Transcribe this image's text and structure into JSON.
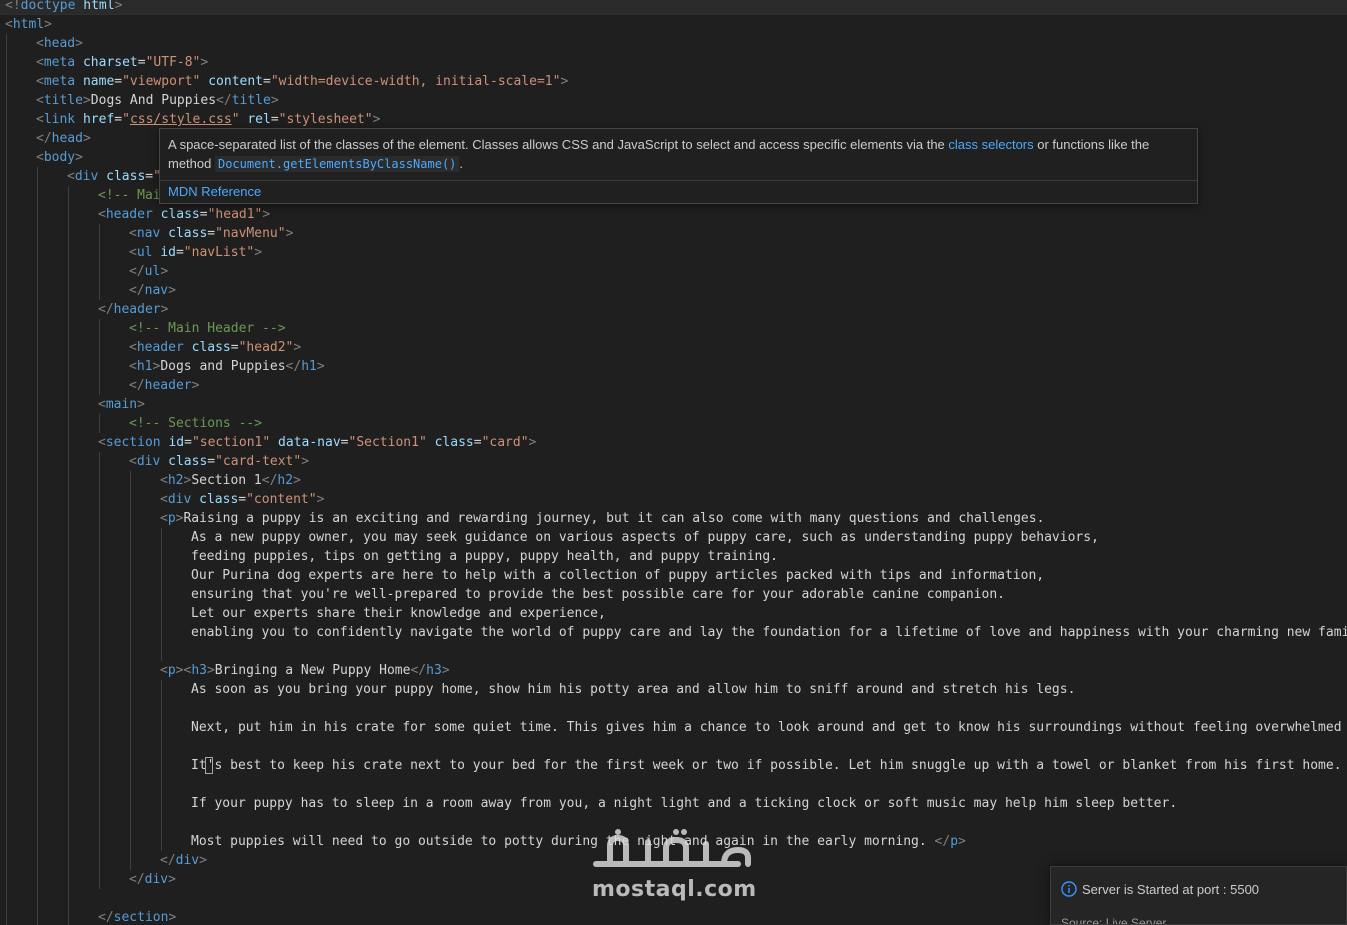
{
  "code_lines": [
    {
      "indent": 0,
      "tokens": [
        {
          "c": "br",
          "t": "<!"
        },
        {
          "c": "kw",
          "t": "doctype"
        },
        {
          "c": "text",
          "t": " "
        },
        {
          "c": "attr",
          "t": "html"
        },
        {
          "c": "br",
          "t": ">"
        }
      ]
    },
    {
      "indent": 0,
      "tokens": [
        {
          "c": "br",
          "t": "<"
        },
        {
          "c": "tag",
          "t": "html"
        },
        {
          "c": "br",
          "t": ">"
        }
      ]
    },
    {
      "indent": 1,
      "tokens": [
        {
          "c": "br",
          "t": "<"
        },
        {
          "c": "tag",
          "t": "head"
        },
        {
          "c": "br",
          "t": ">"
        }
      ]
    },
    {
      "indent": 1,
      "tokens": [
        {
          "c": "br",
          "t": "<"
        },
        {
          "c": "tag",
          "t": "meta"
        },
        {
          "c": "text",
          "t": " "
        },
        {
          "c": "attr",
          "t": "charset"
        },
        {
          "c": "eq",
          "t": "="
        },
        {
          "c": "str",
          "t": "\"UTF-8\""
        },
        {
          "c": "br",
          "t": ">"
        }
      ]
    },
    {
      "indent": 1,
      "tokens": [
        {
          "c": "br",
          "t": "<"
        },
        {
          "c": "tag",
          "t": "meta"
        },
        {
          "c": "text",
          "t": " "
        },
        {
          "c": "attr",
          "t": "name"
        },
        {
          "c": "eq",
          "t": "="
        },
        {
          "c": "str",
          "t": "\"viewport\""
        },
        {
          "c": "text",
          "t": " "
        },
        {
          "c": "attr",
          "t": "content"
        },
        {
          "c": "eq",
          "t": "="
        },
        {
          "c": "str",
          "t": "\"width=device-width, initial-scale=1\""
        },
        {
          "c": "br",
          "t": ">"
        }
      ]
    },
    {
      "indent": 1,
      "tokens": [
        {
          "c": "br",
          "t": "<"
        },
        {
          "c": "tag",
          "t": "title"
        },
        {
          "c": "br",
          "t": ">"
        },
        {
          "c": "text",
          "t": "Dogs And Puppies"
        },
        {
          "c": "br",
          "t": "</"
        },
        {
          "c": "tag",
          "t": "title"
        },
        {
          "c": "br",
          "t": ">"
        }
      ]
    },
    {
      "indent": 1,
      "tokens": [
        {
          "c": "br",
          "t": "<"
        },
        {
          "c": "tag",
          "t": "link"
        },
        {
          "c": "text",
          "t": " "
        },
        {
          "c": "attr",
          "t": "href"
        },
        {
          "c": "eq",
          "t": "="
        },
        {
          "c": "str",
          "t": "\""
        },
        {
          "c": "link",
          "t": "css/style.css"
        },
        {
          "c": "str",
          "t": "\""
        },
        {
          "c": "text",
          "t": " "
        },
        {
          "c": "attr",
          "t": "rel"
        },
        {
          "c": "eq",
          "t": "="
        },
        {
          "c": "str",
          "t": "\"stylesheet\""
        },
        {
          "c": "br",
          "t": ">"
        }
      ]
    },
    {
      "indent": 1,
      "tokens": [
        {
          "c": "br",
          "t": "</"
        },
        {
          "c": "tag",
          "t": "head"
        },
        {
          "c": "br",
          "t": ">"
        }
      ]
    },
    {
      "indent": 1,
      "tokens": [
        {
          "c": "br",
          "t": "<"
        },
        {
          "c": "tag",
          "t": "body"
        },
        {
          "c": "br",
          "t": ">"
        }
      ]
    },
    {
      "indent": 2,
      "tokens": [
        {
          "c": "br",
          "t": "<"
        },
        {
          "c": "tag",
          "t": "div"
        },
        {
          "c": "text",
          "t": " "
        },
        {
          "c": "attr",
          "t": "class"
        },
        {
          "c": "eq",
          "t": "="
        },
        {
          "c": "str",
          "t": "\""
        }
      ]
    },
    {
      "indent": 3,
      "tokens": [
        {
          "c": "com",
          "t": "<!-- Mai"
        }
      ]
    },
    {
      "indent": 3,
      "tokens": [
        {
          "c": "br",
          "t": "<"
        },
        {
          "c": "tag",
          "t": "header"
        },
        {
          "c": "text",
          "t": " "
        },
        {
          "c": "attr",
          "t": "class"
        },
        {
          "c": "eq",
          "t": "="
        },
        {
          "c": "str",
          "t": "\"head1\""
        },
        {
          "c": "br",
          "t": ">"
        }
      ]
    },
    {
      "indent": 4,
      "tokens": [
        {
          "c": "br",
          "t": "<"
        },
        {
          "c": "tag",
          "t": "nav"
        },
        {
          "c": "text",
          "t": " "
        },
        {
          "c": "attr",
          "t": "class"
        },
        {
          "c": "eq",
          "t": "="
        },
        {
          "c": "str",
          "t": "\"navMenu\""
        },
        {
          "c": "br",
          "t": ">"
        }
      ]
    },
    {
      "indent": 4,
      "tokens": [
        {
          "c": "br",
          "t": "<"
        },
        {
          "c": "tag",
          "t": "ul"
        },
        {
          "c": "text",
          "t": " "
        },
        {
          "c": "attr",
          "t": "id"
        },
        {
          "c": "eq",
          "t": "="
        },
        {
          "c": "str",
          "t": "\"navList\""
        },
        {
          "c": "br",
          "t": ">"
        }
      ]
    },
    {
      "indent": 4,
      "tokens": [
        {
          "c": "br",
          "t": "</"
        },
        {
          "c": "tag",
          "t": "ul"
        },
        {
          "c": "br",
          "t": ">"
        }
      ]
    },
    {
      "indent": 4,
      "tokens": [
        {
          "c": "br",
          "t": "</"
        },
        {
          "c": "tag",
          "t": "nav"
        },
        {
          "c": "br",
          "t": ">"
        }
      ]
    },
    {
      "indent": 3,
      "tokens": [
        {
          "c": "br",
          "t": "</"
        },
        {
          "c": "tag",
          "t": "header"
        },
        {
          "c": "br",
          "t": ">"
        }
      ]
    },
    {
      "indent": 4,
      "tokens": [
        {
          "c": "com",
          "t": "<!-- Main Header -->"
        }
      ]
    },
    {
      "indent": 4,
      "tokens": [
        {
          "c": "br",
          "t": "<"
        },
        {
          "c": "tag",
          "t": "header"
        },
        {
          "c": "text",
          "t": " "
        },
        {
          "c": "attr",
          "t": "class"
        },
        {
          "c": "eq",
          "t": "="
        },
        {
          "c": "str",
          "t": "\"head2\""
        },
        {
          "c": "br",
          "t": ">"
        }
      ]
    },
    {
      "indent": 4,
      "tokens": [
        {
          "c": "br",
          "t": "<"
        },
        {
          "c": "tag",
          "t": "h1"
        },
        {
          "c": "br",
          "t": ">"
        },
        {
          "c": "text",
          "t": "Dogs and Puppies"
        },
        {
          "c": "br",
          "t": "</"
        },
        {
          "c": "tag",
          "t": "h1"
        },
        {
          "c": "br",
          "t": ">"
        }
      ]
    },
    {
      "indent": 4,
      "tokens": [
        {
          "c": "br",
          "t": "</"
        },
        {
          "c": "tag",
          "t": "header"
        },
        {
          "c": "br",
          "t": ">"
        }
      ]
    },
    {
      "indent": 3,
      "tokens": [
        {
          "c": "br",
          "t": "<"
        },
        {
          "c": "tag",
          "t": "main"
        },
        {
          "c": "br",
          "t": ">"
        }
      ]
    },
    {
      "indent": 4,
      "tokens": [
        {
          "c": "com",
          "t": "<!-- Sections -->"
        }
      ]
    },
    {
      "indent": 3,
      "tokens": [
        {
          "c": "br",
          "t": "<"
        },
        {
          "c": "tag",
          "t": "section"
        },
        {
          "c": "text",
          "t": " "
        },
        {
          "c": "attr",
          "t": "id"
        },
        {
          "c": "eq",
          "t": "="
        },
        {
          "c": "str",
          "t": "\"section1\""
        },
        {
          "c": "text",
          "t": " "
        },
        {
          "c": "attr",
          "t": "data-nav"
        },
        {
          "c": "eq",
          "t": "="
        },
        {
          "c": "str",
          "t": "\"Section1\""
        },
        {
          "c": "text",
          "t": " "
        },
        {
          "c": "attr",
          "t": "class"
        },
        {
          "c": "eq",
          "t": "="
        },
        {
          "c": "str",
          "t": "\"card\""
        },
        {
          "c": "br",
          "t": ">"
        }
      ]
    },
    {
      "indent": 4,
      "tokens": [
        {
          "c": "br",
          "t": "<"
        },
        {
          "c": "tag",
          "t": "div"
        },
        {
          "c": "text",
          "t": " "
        },
        {
          "c": "attr",
          "t": "class"
        },
        {
          "c": "eq",
          "t": "="
        },
        {
          "c": "str",
          "t": "\"card-text\""
        },
        {
          "c": "br",
          "t": ">"
        }
      ]
    },
    {
      "indent": 5,
      "tokens": [
        {
          "c": "br",
          "t": "<"
        },
        {
          "c": "tag",
          "t": "h2"
        },
        {
          "c": "br",
          "t": ">"
        },
        {
          "c": "text",
          "t": "Section 1"
        },
        {
          "c": "br",
          "t": "</"
        },
        {
          "c": "tag",
          "t": "h2"
        },
        {
          "c": "br",
          "t": ">"
        }
      ]
    },
    {
      "indent": 5,
      "tokens": [
        {
          "c": "br",
          "t": "<"
        },
        {
          "c": "tag",
          "t": "div"
        },
        {
          "c": "text",
          "t": " "
        },
        {
          "c": "attr",
          "t": "class"
        },
        {
          "c": "eq",
          "t": "="
        },
        {
          "c": "str",
          "t": "\"content\""
        },
        {
          "c": "br",
          "t": ">"
        }
      ]
    },
    {
      "indent": 5,
      "tokens": [
        {
          "c": "br",
          "t": "<"
        },
        {
          "c": "tag",
          "t": "p"
        },
        {
          "c": "br",
          "t": ">"
        },
        {
          "c": "text",
          "t": "Raising a puppy is an exciting and rewarding journey, but it can also come with many questions and challenges."
        }
      ]
    },
    {
      "indent": 6,
      "tokens": [
        {
          "c": "text",
          "t": "As a new puppy owner, you may seek guidance on various aspects of puppy care, such as understanding puppy behaviors,"
        }
      ]
    },
    {
      "indent": 6,
      "tokens": [
        {
          "c": "text",
          "t": "feeding puppies, tips on getting a puppy, puppy health, and puppy training."
        }
      ]
    },
    {
      "indent": 6,
      "tokens": [
        {
          "c": "text",
          "t": "Our Purina dog experts are here to help with a collection of puppy articles packed with tips and information,"
        }
      ]
    },
    {
      "indent": 6,
      "tokens": [
        {
          "c": "text",
          "t": "ensuring that you're well-prepared to provide the best possible care for your adorable canine companion."
        }
      ]
    },
    {
      "indent": 6,
      "tokens": [
        {
          "c": "text",
          "t": "Let our experts share their knowledge and experience,"
        }
      ]
    },
    {
      "indent": 6,
      "tokens": [
        {
          "c": "text",
          "t": "enabling you to confidently navigate the world of puppy care and lay the foundation for a lifetime of love and happiness with your charming new family"
        }
      ]
    },
    {
      "indent": 6,
      "tokens": []
    },
    {
      "indent": 5,
      "tokens": [
        {
          "c": "br",
          "t": "<"
        },
        {
          "c": "tag",
          "t": "p"
        },
        {
          "c": "br",
          "t": "><"
        },
        {
          "c": "tag",
          "t": "h3"
        },
        {
          "c": "br",
          "t": ">"
        },
        {
          "c": "text",
          "t": "Bringing a New Puppy Home"
        },
        {
          "c": "br",
          "t": "</"
        },
        {
          "c": "tag",
          "t": "h3"
        },
        {
          "c": "br",
          "t": ">"
        }
      ]
    },
    {
      "indent": 6,
      "tokens": [
        {
          "c": "text",
          "t": "As soon as you bring your puppy home, show him his potty area and allow him to sniff around and stretch his legs."
        }
      ]
    },
    {
      "indent": 6,
      "tokens": []
    },
    {
      "indent": 6,
      "tokens": [
        {
          "c": "text",
          "t": "Next, put him in his crate for some quiet time. This gives him a chance to look around and get to know his surroundings without feeling overwhelmed wit"
        }
      ]
    },
    {
      "indent": 6,
      "tokens": []
    },
    {
      "indent": 6,
      "tokens": [
        {
          "c": "text",
          "t": "It's best to keep his crate next to your bed for the first week or two if possible. Let him snuggle up with a towel or blanket from his first home. The"
        }
      ]
    },
    {
      "indent": 6,
      "tokens": []
    },
    {
      "indent": 6,
      "tokens": [
        {
          "c": "text",
          "t": "If your puppy has to sleep in a room away from you, a night light and a ticking clock or soft music may help him sleep better."
        }
      ]
    },
    {
      "indent": 6,
      "tokens": []
    },
    {
      "indent": 6,
      "tokens": [
        {
          "c": "text",
          "t": "Most puppies will need to go outside to potty during the night and again in the early morning. "
        },
        {
          "c": "br",
          "t": "</"
        },
        {
          "c": "tag",
          "t": "p"
        },
        {
          "c": "br",
          "t": ">"
        }
      ]
    },
    {
      "indent": 5,
      "tokens": [
        {
          "c": "br",
          "t": "</"
        },
        {
          "c": "tag",
          "t": "div"
        },
        {
          "c": "br",
          "t": ">"
        }
      ]
    },
    {
      "indent": 4,
      "tokens": [
        {
          "c": "br",
          "t": "</"
        },
        {
          "c": "tag",
          "t": "div"
        },
        {
          "c": "br",
          "t": ">"
        }
      ]
    },
    {
      "indent": 3,
      "tokens": []
    },
    {
      "indent": 3,
      "tokens": [
        {
          "c": "br",
          "t": "</"
        },
        {
          "c": "tag",
          "t": "section"
        },
        {
          "c": "br",
          "t": ">"
        }
      ]
    }
  ],
  "hover": {
    "desc_part1": "A space-separated list of the classes of the element. Classes allows CSS and JavaScript to select and access specific elements via the ",
    "link_text": "class selectors",
    "desc_part2": " or functions like the method ",
    "code_text": "Document.getElementsByClassName()",
    "desc_end": ".",
    "reference": "MDN Reference"
  },
  "watermark": {
    "brand_text": "mostaql.com"
  },
  "notification": {
    "message": "Server is Started at port : 5500",
    "source": "Source: Live Server",
    "icon": "info-icon"
  },
  "colors": {
    "background": "#1f1f1f",
    "tag": "#569cd6",
    "attribute": "#9cdcfe",
    "string": "#ce9178",
    "comment": "#6a9955",
    "bracket": "#808080",
    "link": "#4daafc"
  }
}
